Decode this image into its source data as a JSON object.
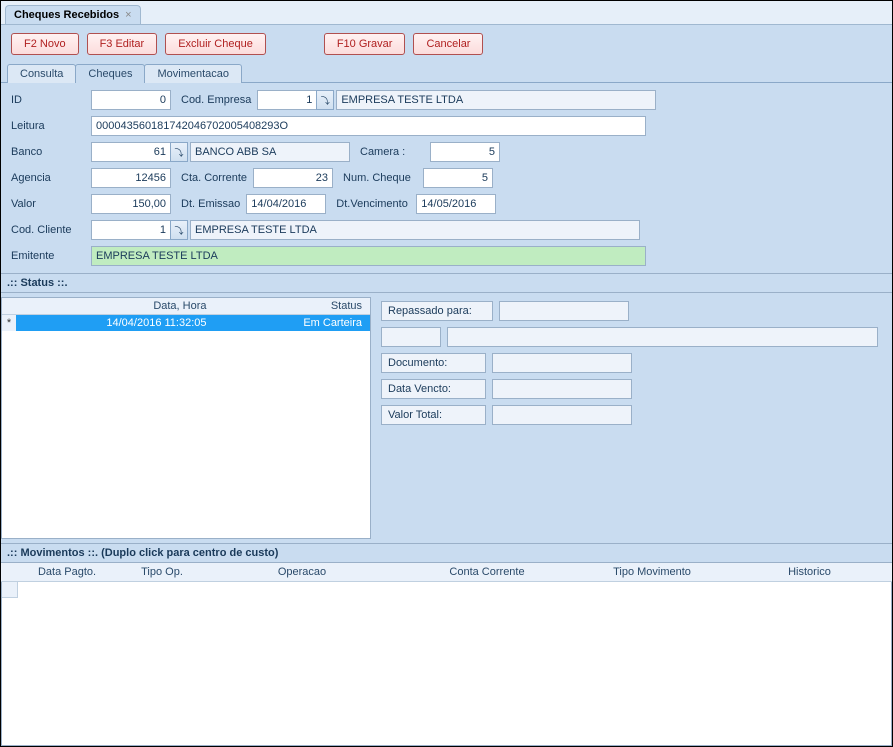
{
  "window": {
    "title": "Cheques Recebidos"
  },
  "toolbar": {
    "novo": "F2 Novo",
    "editar": "F3 Editar",
    "excluir": "Excluir Cheque",
    "gravar": "F10 Gravar",
    "cancelar": "Cancelar"
  },
  "tabs": {
    "consulta": "Consulta",
    "cheques": "Cheques",
    "movimentacao": "Movimentacao"
  },
  "form": {
    "labels": {
      "id": "ID",
      "cod_empresa": "Cod. Empresa",
      "leitura": "Leitura",
      "banco": "Banco",
      "camera": "Camera :",
      "agencia": "Agencia",
      "cta_corrente": "Cta. Corrente",
      "num_cheque": "Num. Cheque",
      "valor": "Valor",
      "dt_emissao": "Dt. Emissao",
      "dt_vencimento": "Dt.Vencimento",
      "cod_cliente": "Cod. Cliente",
      "emitente": "Emitente"
    },
    "values": {
      "id": "0",
      "cod_empresa": "1",
      "empresa_nome": "EMPRESA TESTE LTDA",
      "leitura": "000043560181742046702005408293O",
      "banco": "61",
      "banco_nome": "BANCO ABB SA",
      "camera": "5",
      "agencia": "12456",
      "cta_corrente": "23",
      "num_cheque": "5",
      "valor": "150,00",
      "dt_emissao": "14/04/2016",
      "dt_vencimento": "14/05/2016",
      "cod_cliente": "1",
      "cliente_nome": "EMPRESA TESTE LTDA",
      "emitente": "EMPRESA TESTE LTDA"
    }
  },
  "status": {
    "header": ".:: Status ::.",
    "columns": {
      "data_hora": "Data, Hora",
      "status": "Status"
    },
    "rows": [
      {
        "mark": "*",
        "data_hora": "14/04/2016 11:32:05",
        "status": "Em Carteira"
      }
    ],
    "side": {
      "repassado_para": "Repassado para:",
      "documento": "Documento:",
      "data_vencto": "Data Vencto:",
      "valor_total": "Valor Total:"
    }
  },
  "movimentos": {
    "header": ".:: Movimentos ::.  (Duplo click para centro de custo)",
    "columns": {
      "data_pagto": "Data Pagto.",
      "tipo_op": "Tipo Op.",
      "operacao": "Operacao",
      "conta_corrente": "Conta Corrente",
      "tipo_movimento": "Tipo Movimento",
      "historico": "Historico"
    }
  }
}
